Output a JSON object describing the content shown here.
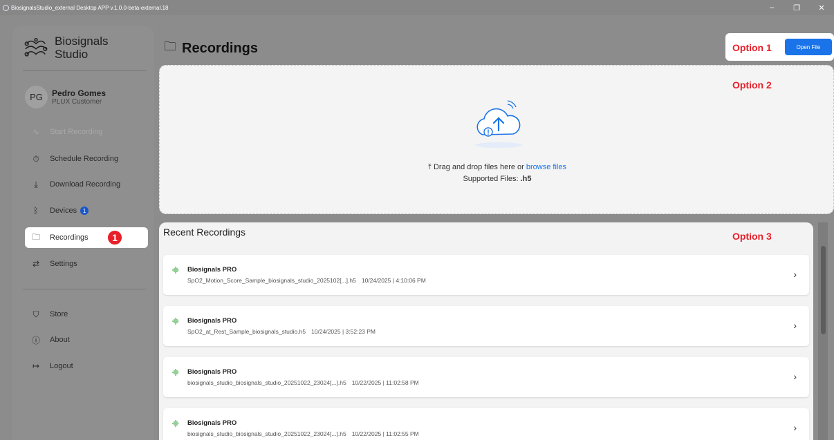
{
  "window": {
    "title": "BiosignalsStudio_external Desktop APP v.1.0.0-beta-external.18",
    "minimize": "–",
    "maximize": "❐",
    "close": "✕"
  },
  "sidebar": {
    "logo_line1": "Biosignals",
    "logo_line2": "Studio",
    "user": {
      "initials": "PG",
      "name": "Pedro Gomes",
      "role": "PLUX Customer"
    },
    "items": [
      {
        "label": "Start Recording",
        "icon": "pulse-icon",
        "glyph": "∿",
        "disabled": true
      },
      {
        "label": "Schedule Recording",
        "icon": "timer-icon",
        "glyph": "⏱"
      },
      {
        "label": "Download Recording",
        "icon": "download-icon",
        "glyph": "⤓"
      },
      {
        "label": "Devices",
        "icon": "bluetooth-icon",
        "glyph": "ᛒ",
        "badge": "1"
      },
      {
        "label": "Recordings",
        "icon": "folder-icon",
        "glyph": "🗀",
        "active": true
      },
      {
        "label": "Settings",
        "icon": "settings-icon",
        "glyph": "⇄"
      },
      {
        "label": "Store",
        "icon": "cart-icon",
        "glyph": "⛉"
      },
      {
        "label": "About",
        "icon": "info-icon",
        "glyph": "ⓘ"
      },
      {
        "label": "Logout",
        "icon": "logout-icon",
        "glyph": "↦"
      }
    ],
    "callout": "1"
  },
  "main": {
    "title": "Recordings",
    "option1": "Option 1",
    "option2": "Option 2",
    "option3": "Option 3",
    "open_file": "Open File",
    "dropzone": {
      "text": "Drag and drop files here or",
      "link": "browse files",
      "supported_label": "Supported Files:",
      "supported_ext": ".h5"
    },
    "recent_title": "Recent Recordings",
    "recordings": [
      {
        "device": "Biosignals PRO",
        "file": "SpO2_Motion_Score_Sample_biosignals_studio_2025102[...].h5",
        "timestamp": "10/24/2025 | 4:10:06 PM"
      },
      {
        "device": "Biosignals PRO",
        "file": "SpO2_at_Rest_Sample_biosignals_studio.h5",
        "timestamp": "10/24/2025 | 3:52:23 PM"
      },
      {
        "device": "Biosignals PRO",
        "file": "biosignals_studio_biosignals_studio_20251022_23024[...].h5",
        "timestamp": "10/22/2025 | 11:02:58 PM"
      },
      {
        "device": "Biosignals PRO",
        "file": "biosignals_studio_biosignals_studio_20251022_23024[...].h5",
        "timestamp": "10/22/2025 | 11:02:55 PM"
      }
    ]
  },
  "colors": {
    "accent": "#1a73e8",
    "callout": "#e8202a",
    "wave": "#4caf50"
  }
}
